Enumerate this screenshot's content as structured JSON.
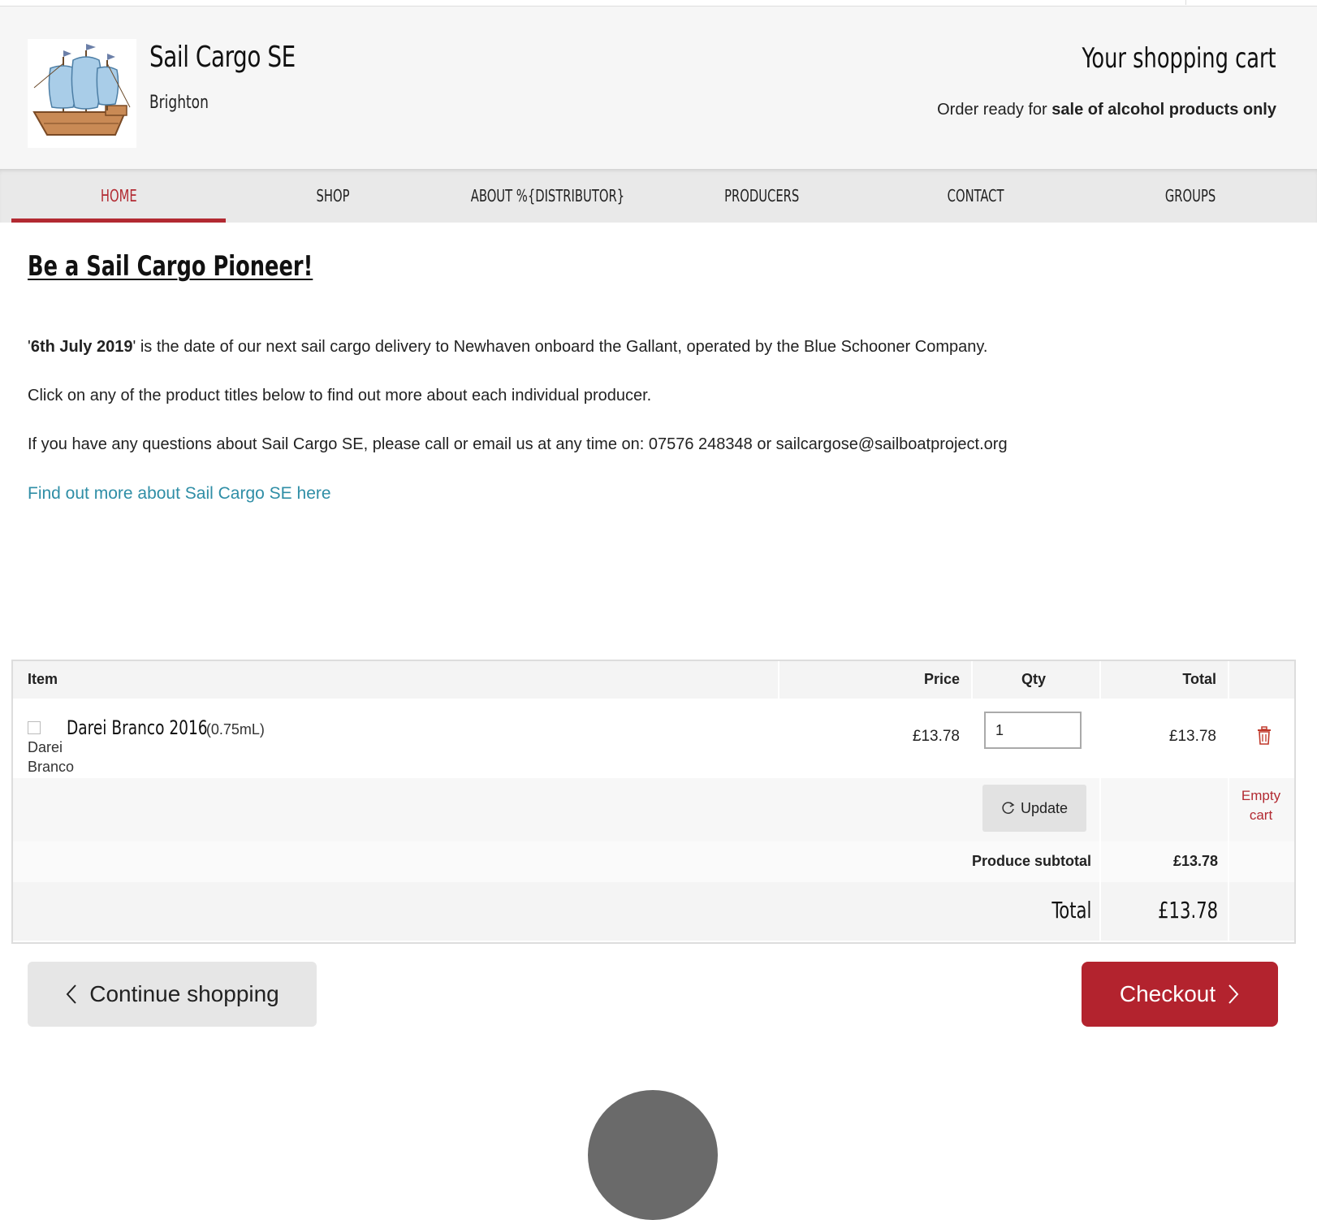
{
  "header": {
    "brand_name": "Sail Cargo SE",
    "brand_location": "Brighton",
    "cart_title": "Your shopping cart",
    "order_ready_prefix": "Order ready for",
    "order_ready_bold": "sale of alcohol products only"
  },
  "nav": {
    "items": [
      {
        "label": "HOME",
        "active": true
      },
      {
        "label": "SHOP"
      },
      {
        "label": "ABOUT %{DISTRIBUTOR}"
      },
      {
        "label": "PRODUCERS"
      },
      {
        "label": "CONTACT"
      },
      {
        "label": "GROUPS"
      }
    ]
  },
  "content": {
    "headline": "Be a Sail Cargo Pioneer!",
    "p1_quote_open": "'",
    "p1_date": "6th July 2019",
    "p1_rest": "' is the date of our next sail cargo delivery to Newhaven onboard the Gallant, operated by the Blue Schooner Company.",
    "p2": "Click on any of the product titles below to find out more about each individual producer.",
    "p3": "If you have any questions about Sail Cargo SE, please call or email us at any time on: 07576 248348 or sailcargose@sailboatproject.org",
    "more_link": "Find out more about Sail Cargo SE here"
  },
  "cart": {
    "headers": {
      "item": "Item",
      "price": "Price",
      "qty": "Qty",
      "total": "Total"
    },
    "items": [
      {
        "image_alt_line1": "Darei",
        "image_alt_line2": "Branco",
        "name": "Darei Branco 2016",
        "size": "(0.75mL)",
        "price": "£13.78",
        "qty": "1",
        "total": "£13.78"
      }
    ],
    "update_label": "Update",
    "empty_cart_line1": "Empty",
    "empty_cart_line2": "cart",
    "subtotal_label": "Produce subtotal",
    "subtotal_value": "£13.78",
    "total_label": "Total",
    "total_value": "£13.78"
  },
  "actions": {
    "continue_label": "Continue shopping",
    "checkout_label": "Checkout"
  },
  "colors": {
    "accent": "#b22a32",
    "link": "#2f8ea6",
    "checkout_bg": "#b3232e"
  }
}
